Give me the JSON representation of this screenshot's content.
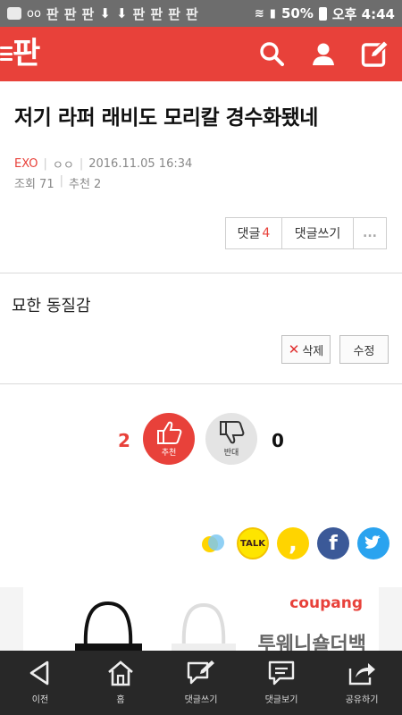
{
  "status_bar": {
    "pan_glyphs": [
      "판",
      "판",
      "판",
      "판",
      "판",
      "판",
      "판"
    ],
    "battery": "50%",
    "time": "오후 4:44"
  },
  "header": {
    "logo": "판",
    "brand_color": "#e8413a"
  },
  "post": {
    "title": "저기 라퍼 래비도 모리칼 경수화됐네",
    "category": "EXO",
    "author": "ㅇㅇ",
    "datetime": "2016.11.05 16:34",
    "views_label": "조회 71",
    "recommend_label": "추천 2",
    "body": "묘한 동질감"
  },
  "buttons": {
    "comment_label": "댓글",
    "comment_count": "4",
    "write_comment": "댓글쓰기",
    "more": "...",
    "delete": "삭제",
    "edit": "수정"
  },
  "votes": {
    "up_count": "2",
    "up_label": "추천",
    "down_label": "반대",
    "down_count": "0"
  },
  "share_icons": [
    "kakao-story-icon",
    "kakaotalk-icon",
    "comma-icon",
    "facebook-icon",
    "twitter-icon"
  ],
  "ad": {
    "brand": "coupang",
    "headline": "투웨니숄더백"
  },
  "bottom_nav": {
    "items": [
      {
        "label": "이전",
        "icon": "back-icon"
      },
      {
        "label": "홈",
        "icon": "home-icon"
      },
      {
        "label": "댓글쓰기",
        "icon": "write-comment-icon"
      },
      {
        "label": "댓글보기",
        "icon": "view-comments-icon"
      },
      {
        "label": "공유하기",
        "icon": "share-icon"
      }
    ]
  }
}
